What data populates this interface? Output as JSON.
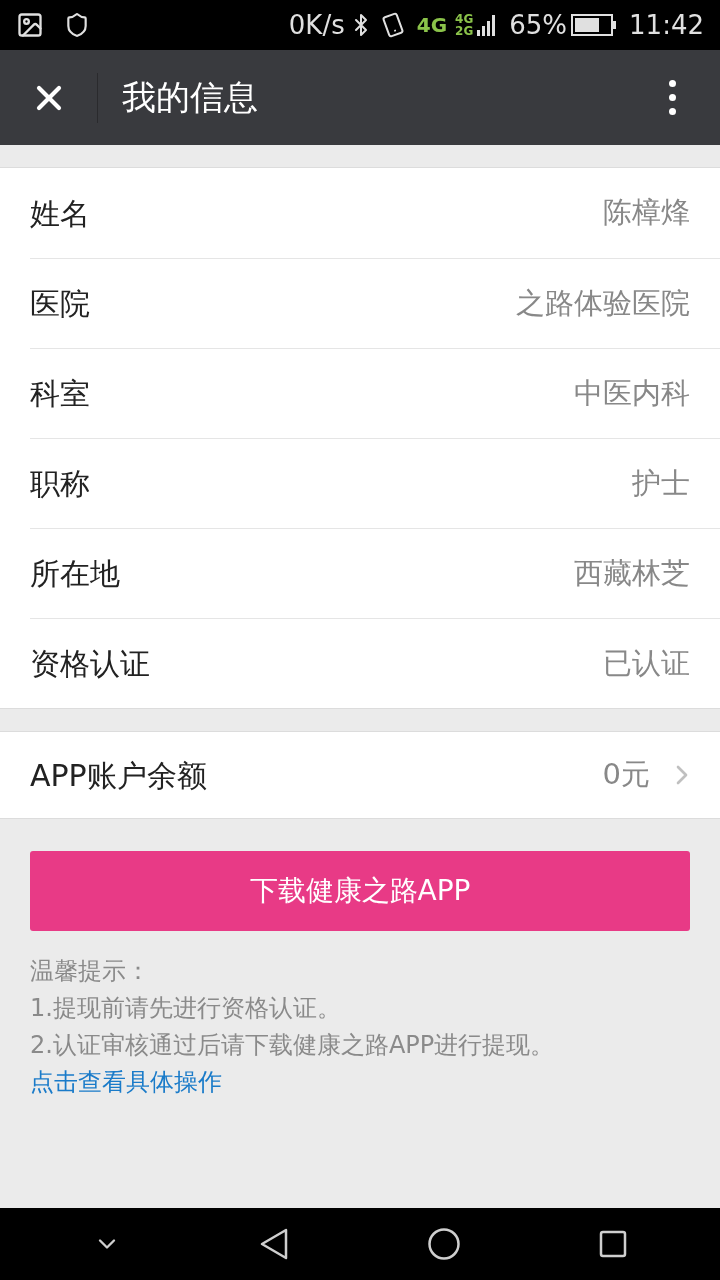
{
  "status_bar": {
    "speed": "0K/s",
    "network": "4G",
    "sim_top": "4G",
    "sim_bottom": "2G",
    "battery": "65%",
    "time": "11:42"
  },
  "header": {
    "title": "我的信息"
  },
  "info_rows": [
    {
      "label": "姓名",
      "value": "陈樟烽"
    },
    {
      "label": "医院",
      "value": "之路体验医院"
    },
    {
      "label": "科室",
      "value": "中医内科"
    },
    {
      "label": "职称",
      "value": "护士"
    },
    {
      "label": "所在地",
      "value": "西藏林芝"
    },
    {
      "label": "资格认证",
      "value": "已认证"
    }
  ],
  "balance": {
    "label": "APP账户余额",
    "value": "0元"
  },
  "download_button": "下载健康之路APP",
  "tips": [
    "温馨提示：",
    "1.提现前请先进行资格认证。",
    "2.认证审核通过后请下载健康之路APP进行提现。"
  ],
  "link": "点击查看具体操作"
}
